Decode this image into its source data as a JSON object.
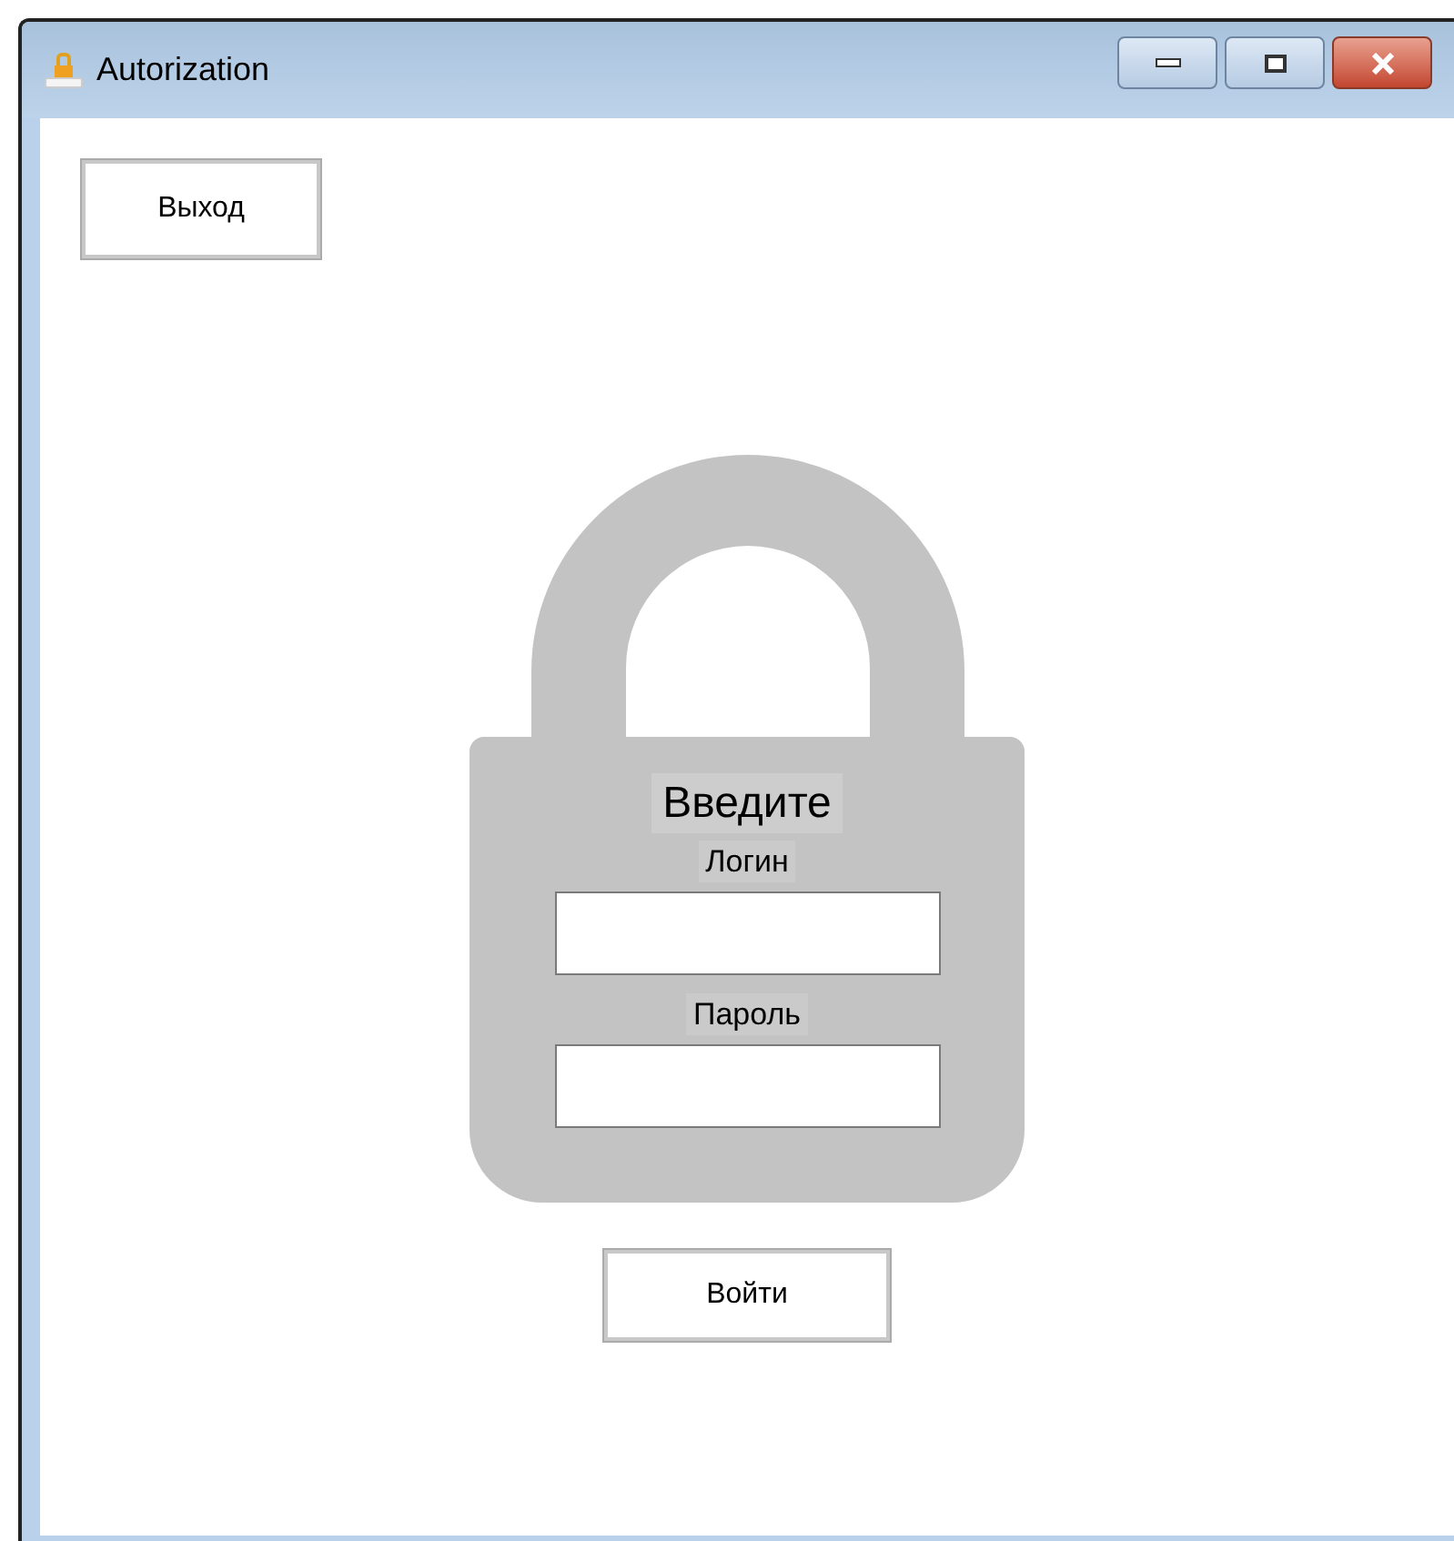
{
  "window": {
    "title": "Autorization"
  },
  "exit_button": {
    "label": "Выход"
  },
  "lock_panel": {
    "heading": "Введите",
    "fields": [
      {
        "label": "Логин"
      },
      {
        "label": "Пароль"
      }
    ]
  },
  "login_button": {
    "label": "Войти"
  }
}
